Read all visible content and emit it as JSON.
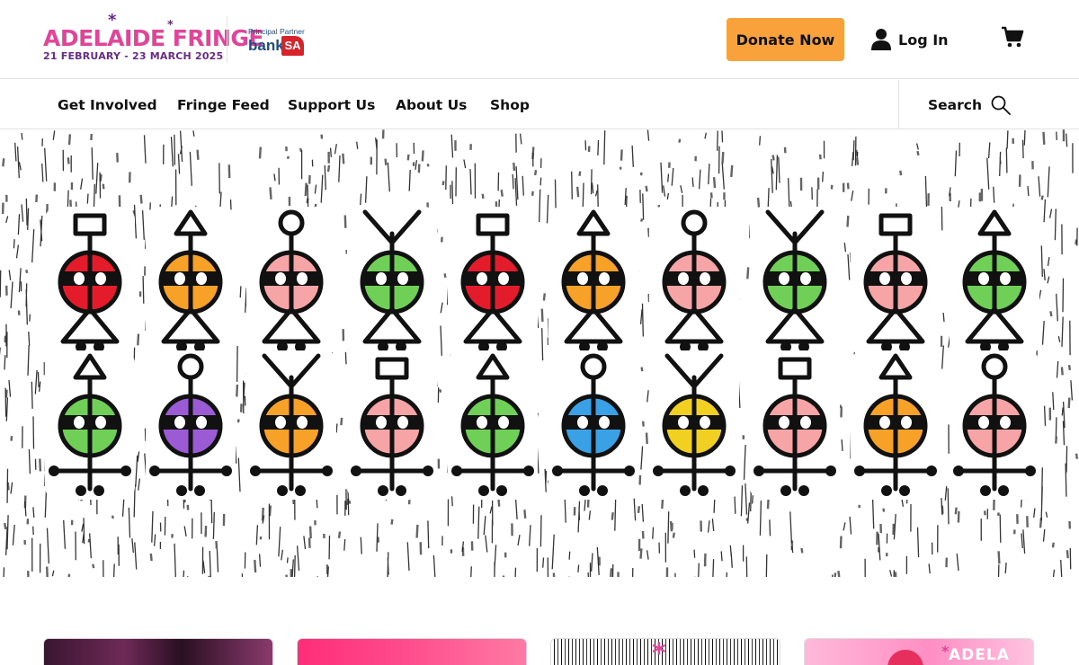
{
  "header": {
    "logo": {
      "wordmark": "ADELAIDE FRINGE",
      "dates": "21 FEBRUARY - 23 MARCH 2025",
      "colors": {
        "pink": "#e0459a",
        "purple": "#6a2a88"
      }
    },
    "partner": {
      "caption": "Principal Partner",
      "bank": "bank",
      "sa": "SA"
    },
    "donate_label": "Donate Now",
    "login_label": "Log In",
    "icons": {
      "user": "user-icon",
      "cart": "cart-icon",
      "search": "search-icon"
    },
    "accent_color": "#f9a13a"
  },
  "nav": {
    "items": [
      {
        "label": "Get Involved"
      },
      {
        "label": "Fringe Feed"
      },
      {
        "label": "Support Us"
      },
      {
        "label": "About Us"
      },
      {
        "label": "Shop"
      }
    ],
    "search_label": "Search"
  },
  "hero": {
    "figure_colors": [
      [
        "#e41b2a",
        "#f7a129",
        "#f6a4a6",
        "#6fcf57",
        "#e41b2a",
        "#f7a129",
        "#f6a4a6",
        "#6fcf57",
        "#f6a4a6",
        "#6fcf57"
      ],
      [
        "#6fcf57",
        "#9b5bd4",
        "#f7a129",
        "#f6a4a6",
        "#6fcf57",
        "#3aa1e6",
        "#f2d021",
        "#f6a4a6",
        "#f7a129",
        "#f6a4a6"
      ]
    ]
  },
  "cards": {
    "c3_glyph": "*",
    "c4_text": "ADELA",
    "c4_star": "*"
  }
}
